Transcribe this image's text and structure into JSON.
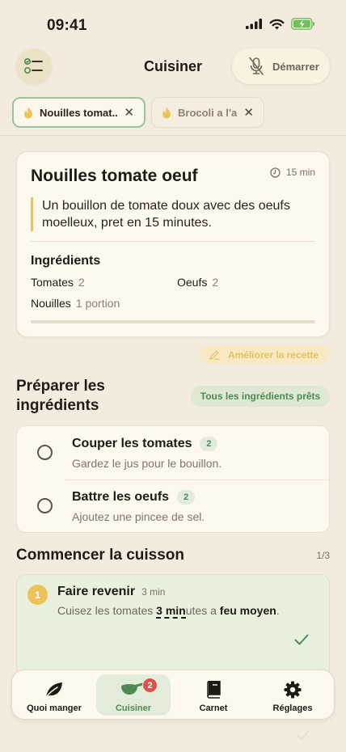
{
  "status_bar": {
    "time": "09:41"
  },
  "header": {
    "title": "Cuisiner",
    "start_label": "Démarrer"
  },
  "tabs": [
    {
      "label": "Nouilles tomat...",
      "active": true
    },
    {
      "label": "Brocoli a l'ail",
      "active": false
    }
  ],
  "recipe": {
    "title": "Nouilles tomate oeuf",
    "time": "15 min",
    "description": "Un bouillon de tomate doux avec des oeufs moelleux, pret en 15 minutes.",
    "ingredients_title": "Ingrédients",
    "ingredients": [
      {
        "name": "Tomates",
        "qty": "2"
      },
      {
        "name": "Oeufs",
        "qty": "2"
      },
      {
        "name": "Nouilles",
        "qty": "1 portion"
      }
    ],
    "progress": 0
  },
  "improve_label": "Améliorer la recette",
  "prep": {
    "title_line1": "Préparer les",
    "title_line2": "ingrédients",
    "ready_label": "Tous les ingrédients prêts",
    "items": [
      {
        "title": "Couper les tomates",
        "count": "2",
        "subtitle": "Gardez le jus pour le bouillon."
      },
      {
        "title": "Battre les oeufs",
        "count": "2",
        "subtitle": "Ajoutez une pincee de sel."
      }
    ]
  },
  "cooking": {
    "title": "Commencer la cuisson",
    "counter": "1/3",
    "step": {
      "number": "1",
      "title": "Faire revenir",
      "duration": "3 min",
      "text_a": "Cuisez les tomates ",
      "text_b": "3 min",
      "text_c": "utes a ",
      "text_d": "feu moyen",
      "text_e": "."
    }
  },
  "nav": [
    {
      "label": "Quoi manger",
      "icon": "leaf-icon"
    },
    {
      "label": "Cuisiner",
      "icon": "pan-icon",
      "badge": "2",
      "active": true
    },
    {
      "label": "Carnet",
      "icon": "book-icon"
    },
    {
      "label": "Réglages",
      "icon": "gear-icon"
    }
  ],
  "colors": {
    "accent_green": "#4f8a55",
    "accent_yellow": "#ecc35a",
    "badge_red": "#d9544b",
    "background": "#f3ecde"
  }
}
